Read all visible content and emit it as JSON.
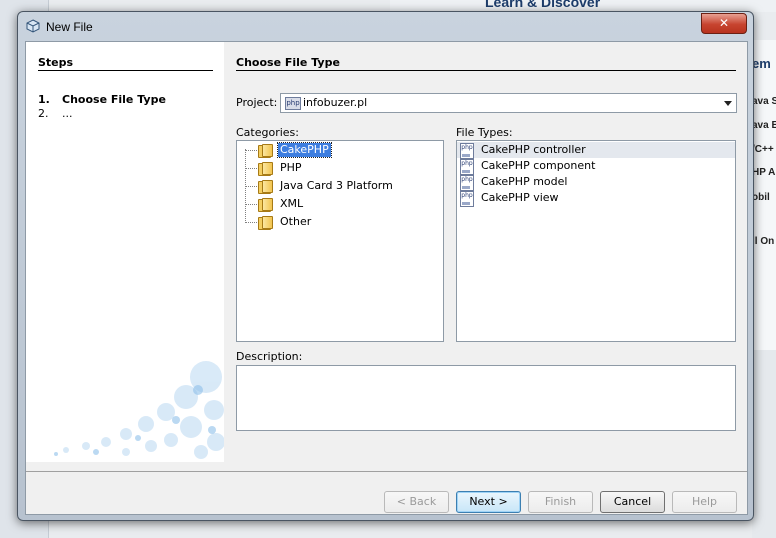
{
  "background": {
    "learn_heading": "Learn & Discover",
    "right_fragments": [
      "em",
      "ava S",
      "ava E",
      "/C++",
      "HP A",
      "obil",
      "ll On"
    ]
  },
  "window": {
    "title": "New File",
    "close_glyph": "✕"
  },
  "steps": {
    "title": "Steps",
    "items": [
      {
        "num": "1.",
        "label": "Choose File Type"
      },
      {
        "num": "2.",
        "label": "..."
      }
    ]
  },
  "main": {
    "title": "Choose File Type",
    "project_label": "Project:",
    "project_value": "infobuzer.pl",
    "project_icon": "php",
    "categories_label": "Categories:",
    "categories": [
      "CakePHP",
      "PHP",
      "Java Card 3 Platform",
      "XML",
      "Other"
    ],
    "selected_category": "CakePHP",
    "file_types_label": "File Types:",
    "file_types": [
      "CakePHP controller",
      "CakePHP component",
      "CakePHP model",
      "CakePHP view"
    ],
    "selected_file_type": "CakePHP controller",
    "description_label": "Description:",
    "description": ""
  },
  "buttons": {
    "back": "< Back",
    "next": "Next >",
    "finish": "Finish",
    "cancel": "Cancel",
    "help": "Help"
  },
  "colors": {
    "selection": "#3d7ee0",
    "close_button": "#c7442f",
    "folder": "#f4cf62"
  }
}
